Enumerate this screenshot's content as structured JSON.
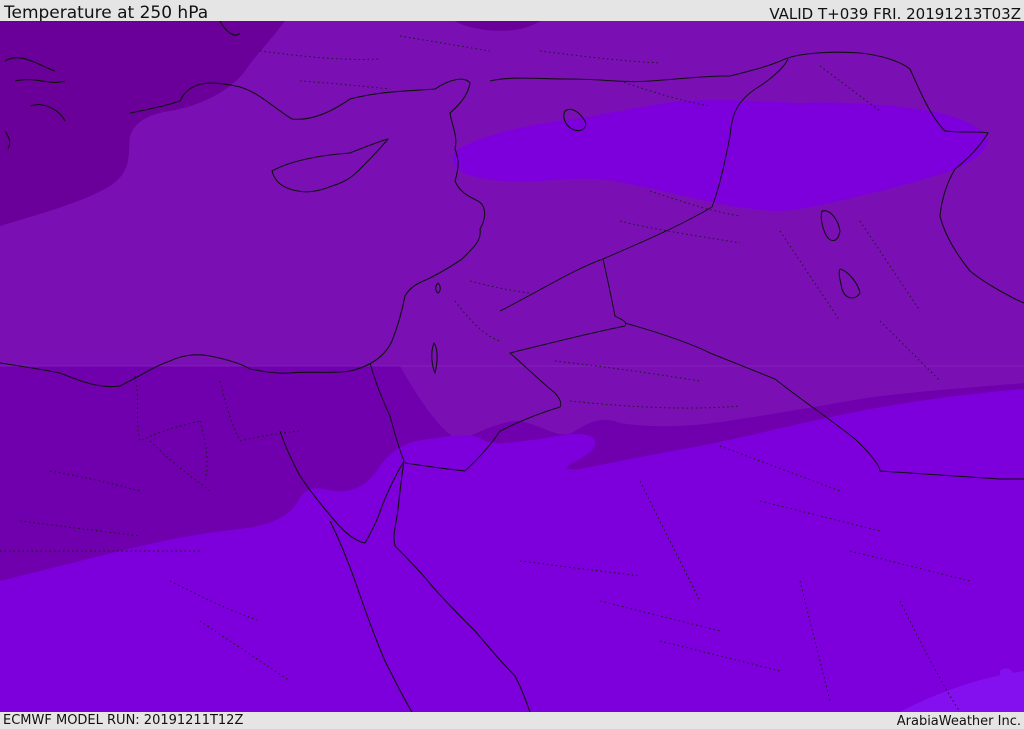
{
  "header": {
    "title": "Temperature at 250 hPa",
    "valid": "VALID T+039 FRI. 20191213T03Z"
  },
  "footer": {
    "model_run": "ECMWF MODEL RUN: 20191211T12Z",
    "credit": "ArabiaWeather Inc."
  },
  "colors": {
    "band_coldest": "#6a0099",
    "band_cold": "#7a10b4",
    "band_mid": "#7000ae",
    "band_warm": "#7d00dc",
    "band_warmest": "#8410f0",
    "coastline": "#111111"
  }
}
